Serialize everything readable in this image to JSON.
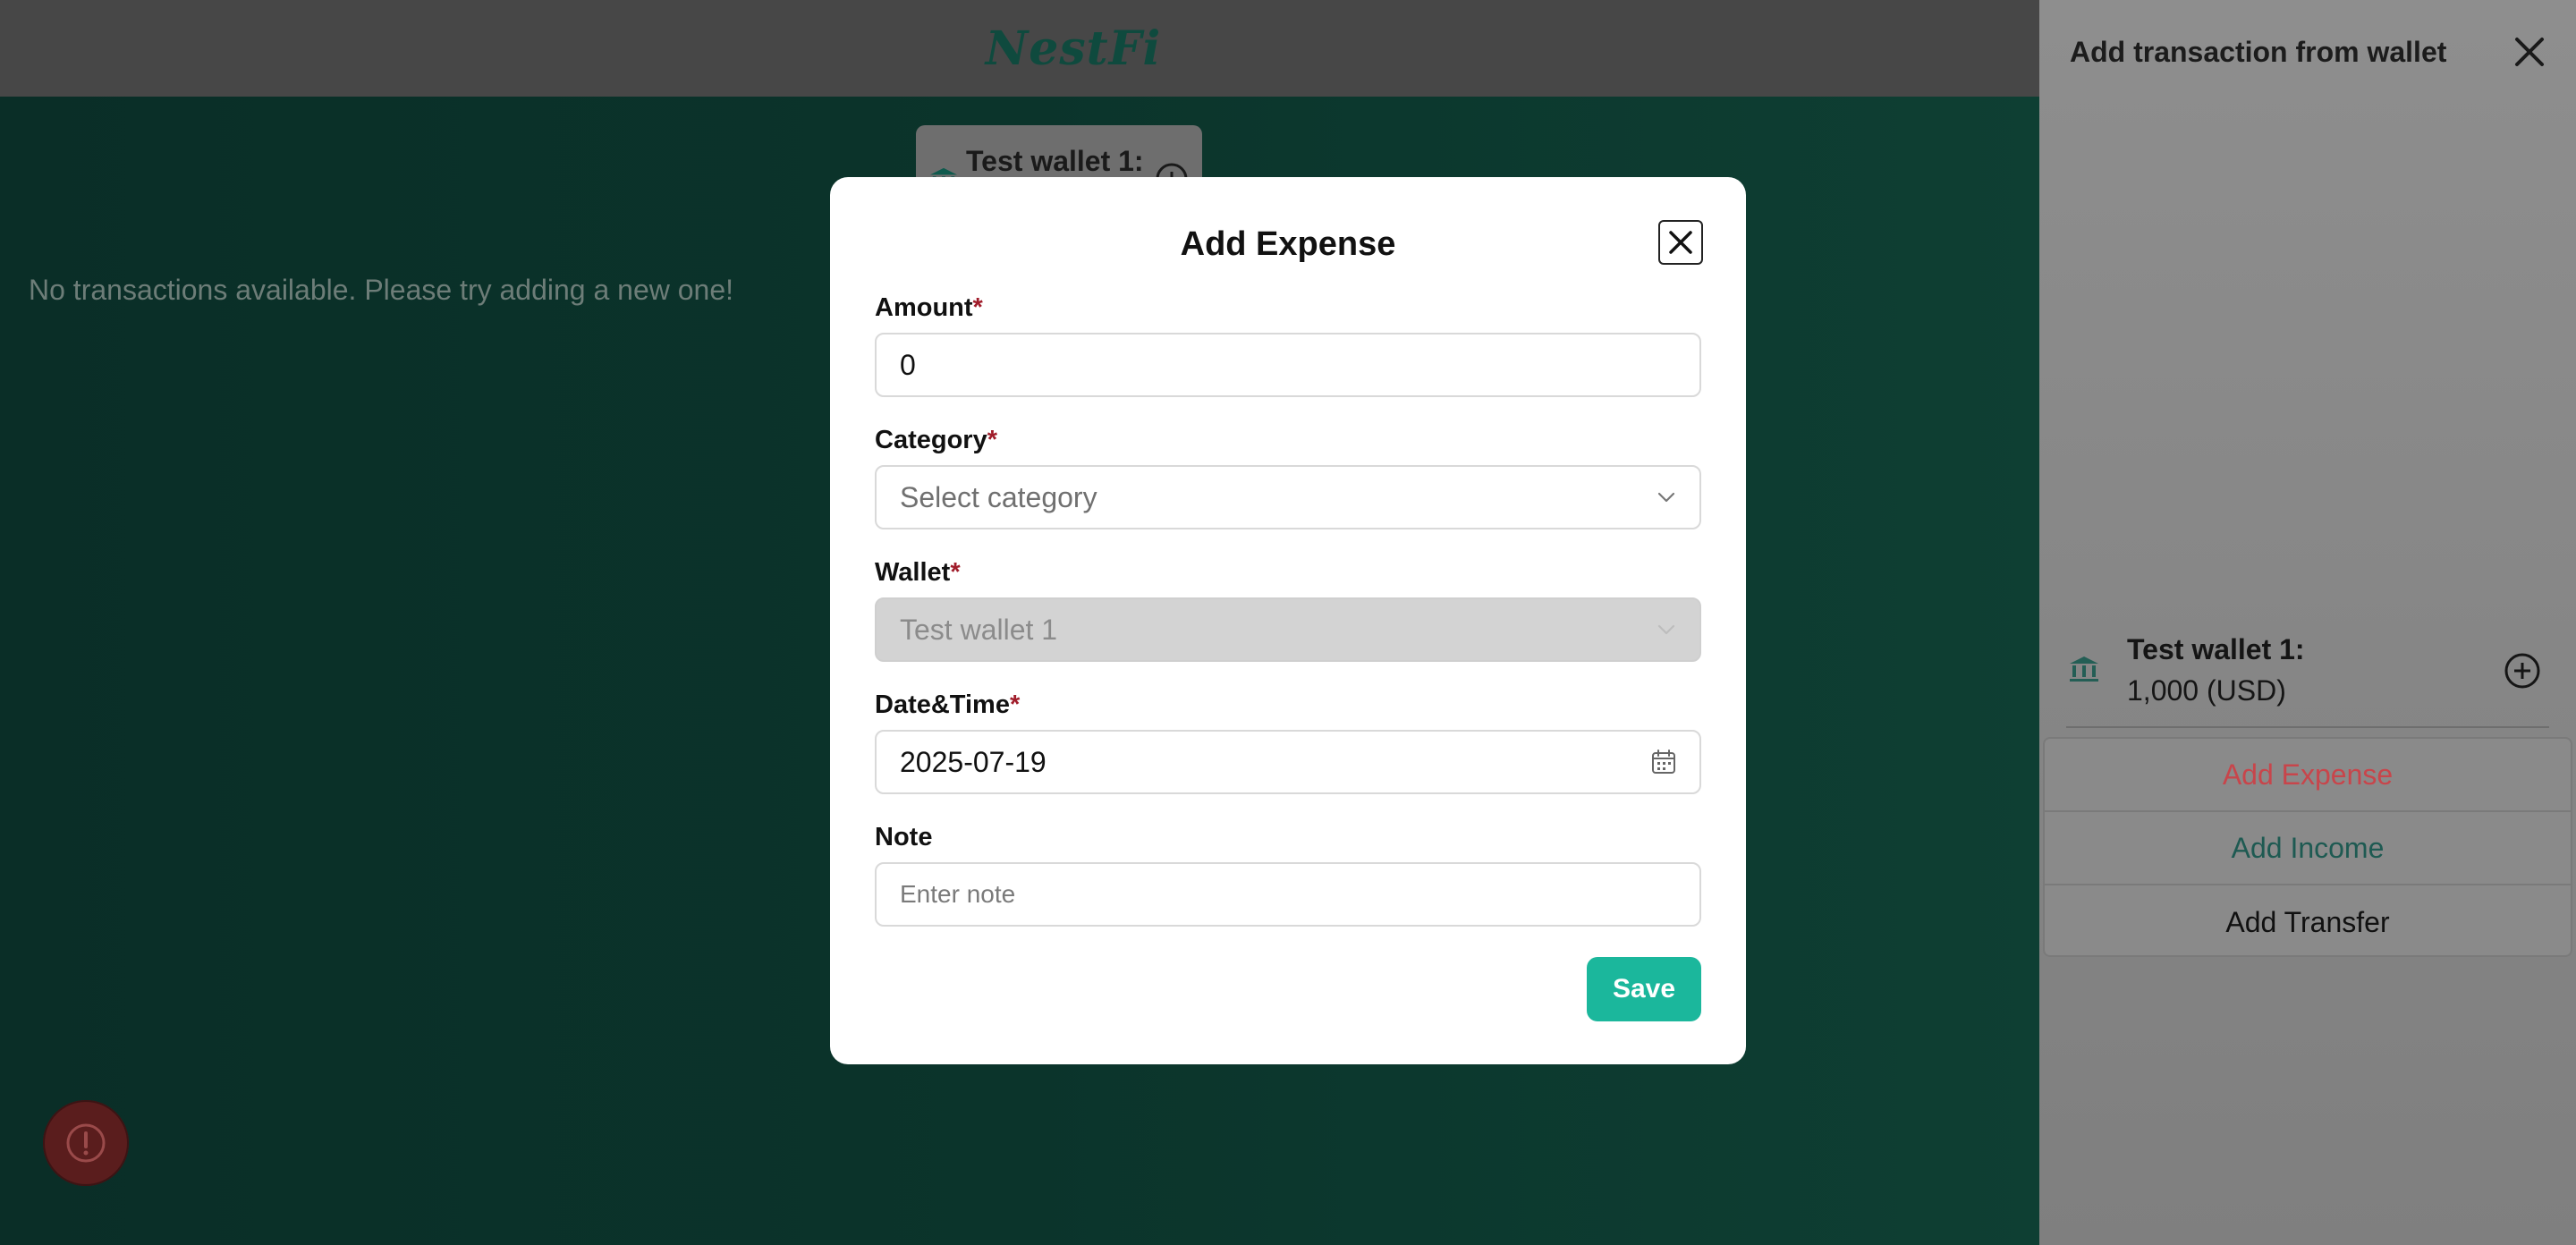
{
  "app": {
    "logo": "NestFi",
    "empty_message": "No transactions available. Please try adding a new one!",
    "wallet_tab_label": "Test wallet 1:"
  },
  "drawer": {
    "title": "Add transaction from wallet",
    "wallet": {
      "name": "Test wallet 1:",
      "balance": "1,000 (USD)"
    },
    "actions": [
      {
        "label": "Add Expense",
        "color": "#c8454b"
      },
      {
        "label": "Add Income",
        "color": "#1e5a52"
      },
      {
        "label": "Add Transfer",
        "color": "#111111"
      }
    ]
  },
  "modal": {
    "title": "Add Expense",
    "required_mark": "*",
    "fields": {
      "amount": {
        "label": "Amount",
        "value": "0"
      },
      "category": {
        "label": "Category",
        "placeholder": "Select category"
      },
      "wallet": {
        "label": "Wallet",
        "value": "Test wallet 1"
      },
      "datetime": {
        "label": "Date&Time",
        "value": "2025-07-19"
      },
      "note": {
        "label": "Note",
        "placeholder": "Enter note"
      }
    },
    "save_label": "Save"
  },
  "colors": {
    "accent": "#1bb79c",
    "required": "#a01c2a",
    "expense": "#c8454b",
    "income": "#1e5a52"
  },
  "icons": {
    "modal_close": "close-icon",
    "drawer_close": "close-icon",
    "category_dropdown": "chevron-down-icon",
    "wallet_dropdown": "chevron-down-icon",
    "date_picker": "calendar-icon",
    "wallet": "bank-icon",
    "add": "plus-circle-icon",
    "report": "alert-circle-icon"
  }
}
